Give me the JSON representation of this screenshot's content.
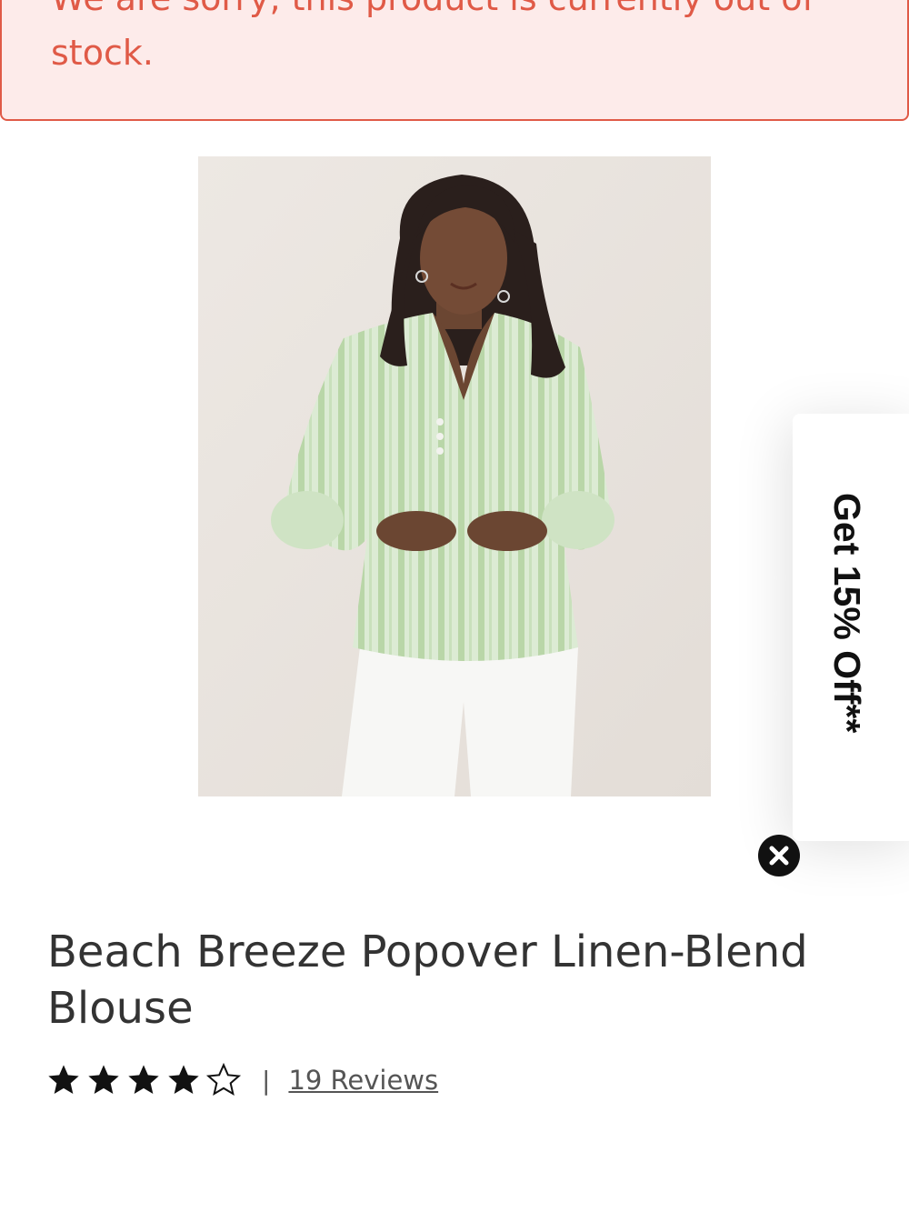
{
  "alert": {
    "message": "We are sorry, this product is currently out of stock."
  },
  "product": {
    "title": "Beach Breeze Popover Linen-Blend Blouse",
    "rating": 4,
    "rating_max": 5,
    "reviews_label": "19 Reviews"
  },
  "promo": {
    "label": "Get 15% Off**"
  },
  "icons": {
    "close": "close-icon",
    "star_filled": "star-filled-icon",
    "star_empty": "star-outline-icon"
  },
  "colors": {
    "alert_text": "#e05a47",
    "alert_background": "#fdebea",
    "blouse": "#cfe3c4"
  }
}
